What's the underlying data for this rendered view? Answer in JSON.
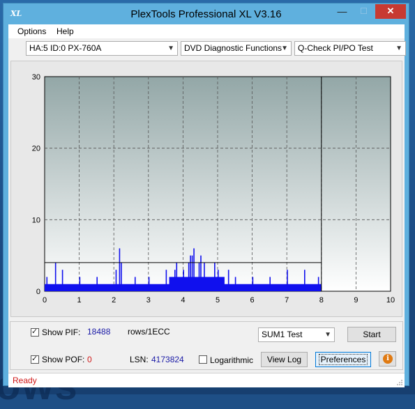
{
  "window": {
    "title": "PlexTools Professional XL V3.16",
    "logo": "XL",
    "minimize_icon": "—",
    "maximize_icon": "☐",
    "close_icon": "✕"
  },
  "menu": {
    "options": "Options",
    "help": "Help"
  },
  "toolbar": {
    "drive": "HA:5 ID:0  PX-760A",
    "function": "DVD Diagnostic Functions",
    "test": "Q-Check PI/PO Test"
  },
  "controls": {
    "show_pif_label": "Show PIF:",
    "pif_value": "18488",
    "rows_label": "rows/1ECC",
    "show_pof_label": "Show POF:",
    "pof_value": "0",
    "lsn_label": "LSN:",
    "lsn_value": "4173824",
    "logarithmic_label": "Logarithmic",
    "sum_select": "SUM1 Test",
    "start_button": "Start",
    "viewlog_button": "View Log",
    "preferences_button": "Preferences",
    "info_icon": "i",
    "show_pif_checked": true,
    "show_pof_checked": true,
    "logarithmic_checked": false
  },
  "status": {
    "text": "Ready"
  },
  "desktop": {
    "background_text": "ows"
  },
  "colors": {
    "bars": "#1010ee",
    "status": "#d01818"
  },
  "chart_data": {
    "type": "bar",
    "x_ticks": [
      "0",
      "1",
      "2",
      "3",
      "4",
      "5",
      "6",
      "7",
      "8",
      "9",
      "10"
    ],
    "y_ticks": [
      "0",
      "10",
      "20",
      "30"
    ],
    "xlim": [
      0,
      10
    ],
    "ylim": [
      0,
      30
    ],
    "grid": true,
    "threshold": 4,
    "cursor_x": 8,
    "data_extent_x": 8,
    "baseline_level": 1,
    "series": [
      {
        "x": [
          0.05,
          0.3,
          0.5,
          1.0,
          1.5,
          2.05,
          2.15,
          2.2,
          2.6,
          3.0,
          3.5,
          3.75,
          3.8,
          4.0,
          4.15,
          4.2,
          4.25,
          4.3,
          4.45,
          4.5,
          4.6,
          4.9,
          5.0,
          5.3,
          5.5,
          6.0,
          6.5,
          7.0,
          7.5,
          7.9
        ],
        "y": [
          2,
          4,
          3,
          2,
          2,
          3,
          6,
          4,
          2,
          2,
          3,
          3,
          4,
          3,
          4,
          5,
          5,
          6,
          4,
          5,
          4,
          4,
          3,
          3,
          2,
          2,
          2,
          3,
          3,
          2
        ]
      }
    ]
  }
}
